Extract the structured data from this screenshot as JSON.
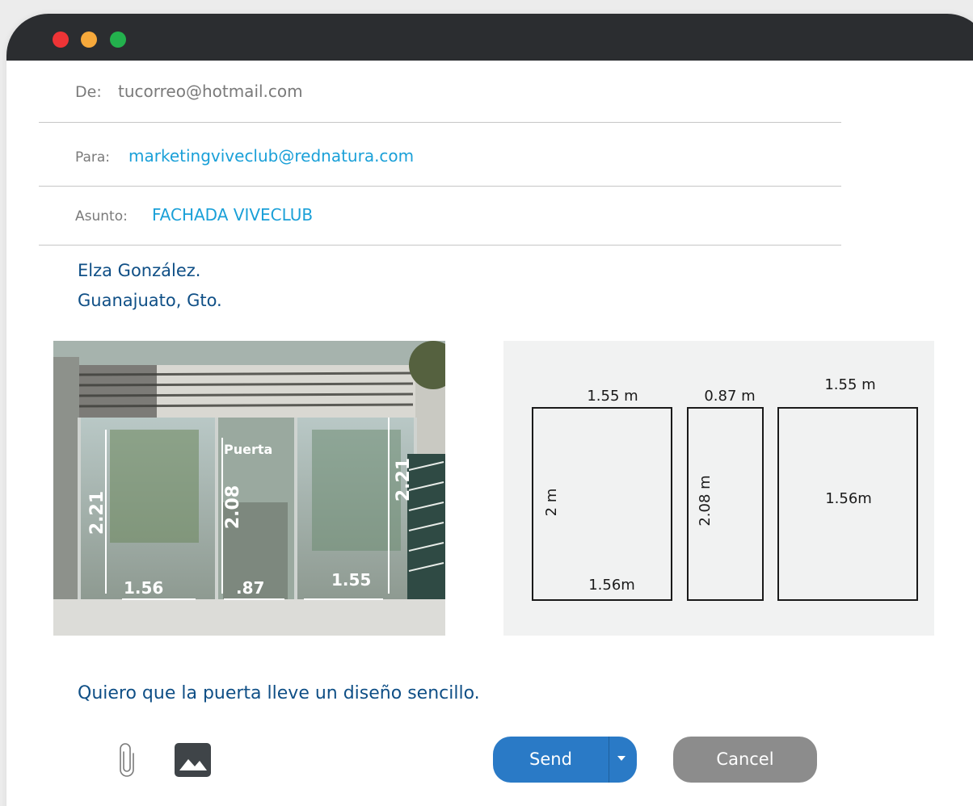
{
  "window": {
    "controls": [
      "close",
      "minimize",
      "maximize"
    ]
  },
  "email": {
    "from_label": "De:",
    "from_value": "tucorreo@hotmail.com",
    "to_label": "Para:",
    "to_value": "marketingviveclub@rednatura.com",
    "subject_label": "Asunto:",
    "subject_value": "FACHADA VIVECLUB",
    "sender_name": "Elza González.",
    "sender_city": "Guanajuato, Gto.",
    "message": "Quiero que la puerta lleve un diseño sencillo."
  },
  "photo": {
    "door_label": "Puerta",
    "height_left": "2.21",
    "height_door": "2.08",
    "height_right": "2.21",
    "width_left": "1.56",
    "width_door": ".87",
    "width_right": "1.55"
  },
  "diagram": {
    "left_top": "1.55 m",
    "left_side": "2 m",
    "left_bottom": "1.56m",
    "middle_top": "0.87 m",
    "middle_side": "2.08 m",
    "right_top": "1.55 m",
    "right_center": "1.56m"
  },
  "toolbar": {
    "attach_icon": "paperclip-icon",
    "image_icon": "image-icon",
    "send_label": "Send",
    "cancel_label": "Cancel"
  },
  "colors": {
    "titlebar": "#2b2d30",
    "link_blue": "#1aa0d8",
    "body_blue": "#0f4f86",
    "send_blue": "#2a7ac6",
    "cancel_gray": "#8c8c8c"
  }
}
